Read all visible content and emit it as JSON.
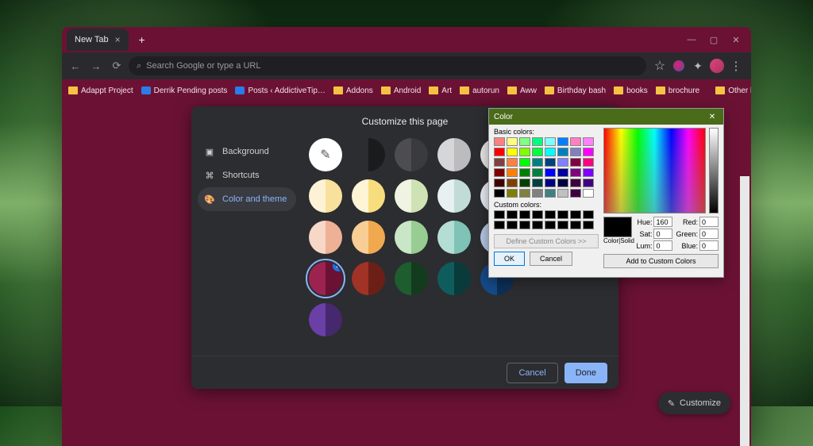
{
  "window": {
    "tab_title": "New Tab",
    "controls": {
      "min": "—",
      "max": "▢",
      "close": "✕"
    }
  },
  "toolbar": {
    "omnibox_placeholder": "Search Google or type a URL"
  },
  "bookmarks": {
    "items": [
      "Adappt Project",
      "Derrik Pending posts",
      "Posts ‹ AddictiveTip…",
      "Addons",
      "Android",
      "Art",
      "autorun",
      "Aww",
      "Birthday bash",
      "books",
      "brochure"
    ],
    "other": "Other bookmarks"
  },
  "dialog": {
    "title": "Customize this page",
    "menu": {
      "background": "Background",
      "shortcuts": "Shortcuts",
      "color_theme": "Color and theme"
    },
    "swatches": [
      {
        "left": "#ffffff",
        "right": "#ffffff",
        "pencil": true
      },
      {
        "left": "#2c2d30",
        "right": "#1a1b1d"
      },
      {
        "left": "#4d4d50",
        "right": "#3a3b3e"
      },
      {
        "left": "#d6d6d8",
        "right": "#bcbcbe"
      },
      {
        "left": "#e9e9ea",
        "right": "#cfcfd1"
      },
      {
        "left": "#fdf2d5",
        "right": "#f8e19d"
      },
      {
        "left": "#fdf4d6",
        "right": "#f7dd7d"
      },
      {
        "left": "#eef4e1",
        "right": "#cfe2b4"
      },
      {
        "left": "#e7f1ef",
        "right": "#c1dcd7"
      },
      {
        "left": "#e9edf5",
        "right": "#c3cee3"
      },
      {
        "left": "#f7d7c6",
        "right": "#eeb196"
      },
      {
        "left": "#f8ce95",
        "right": "#f0a94e"
      },
      {
        "left": "#c9e6c7",
        "right": "#97cd93"
      },
      {
        "left": "#b4ddd6",
        "right": "#7fc3b7"
      },
      {
        "left": "#b7c9e6",
        "right": "#8aa6d4"
      },
      {
        "left": "#9c2350",
        "right": "#6b1234",
        "active": true
      },
      {
        "left": "#a03226",
        "right": "#6c1f17"
      },
      {
        "left": "#1e5d2e",
        "right": "#133b1d"
      },
      {
        "left": "#0f5c5c",
        "right": "#093b3b"
      },
      {
        "left": "#154a87",
        "right": "#0d2f57"
      },
      {
        "left": "#6a3fa6",
        "right": "#46286e"
      }
    ],
    "buttons": {
      "cancel": "Cancel",
      "done": "Done"
    }
  },
  "color_picker": {
    "title": "Color",
    "basic_label": "Basic colors:",
    "custom_label": "Custom colors:",
    "define": "Define Custom Colors >>",
    "ok": "OK",
    "cancel": "Cancel",
    "colorsolid": "Color|Solid",
    "add_custom": "Add to Custom Colors",
    "fields": {
      "hue_l": "Hue:",
      "hue_v": "160",
      "sat_l": "Sat:",
      "sat_v": "0",
      "lum_l": "Lum:",
      "lum_v": "0",
      "red_l": "Red:",
      "red_v": "0",
      "green_l": "Green:",
      "green_v": "0",
      "blue_l": "Blue:",
      "blue_v": "0"
    },
    "basic_colors": [
      "#ff8080",
      "#ffff80",
      "#80ff80",
      "#00ff80",
      "#80ffff",
      "#0080ff",
      "#ff80c0",
      "#ff80ff",
      "#ff0000",
      "#ffff00",
      "#80ff00",
      "#00ff40",
      "#00ffff",
      "#0080c0",
      "#8080c0",
      "#ff00ff",
      "#804040",
      "#ff8040",
      "#00ff00",
      "#008080",
      "#004080",
      "#8080ff",
      "#800040",
      "#ff0080",
      "#800000",
      "#ff8000",
      "#008000",
      "#008040",
      "#0000ff",
      "#0000a0",
      "#800080",
      "#8000ff",
      "#400000",
      "#804000",
      "#004000",
      "#004040",
      "#000080",
      "#000040",
      "#400040",
      "#400080",
      "#000000",
      "#808000",
      "#808040",
      "#808080",
      "#408080",
      "#c0c0c0",
      "#400040",
      "#ffffff"
    ]
  },
  "chip": {
    "label": "Customize"
  }
}
